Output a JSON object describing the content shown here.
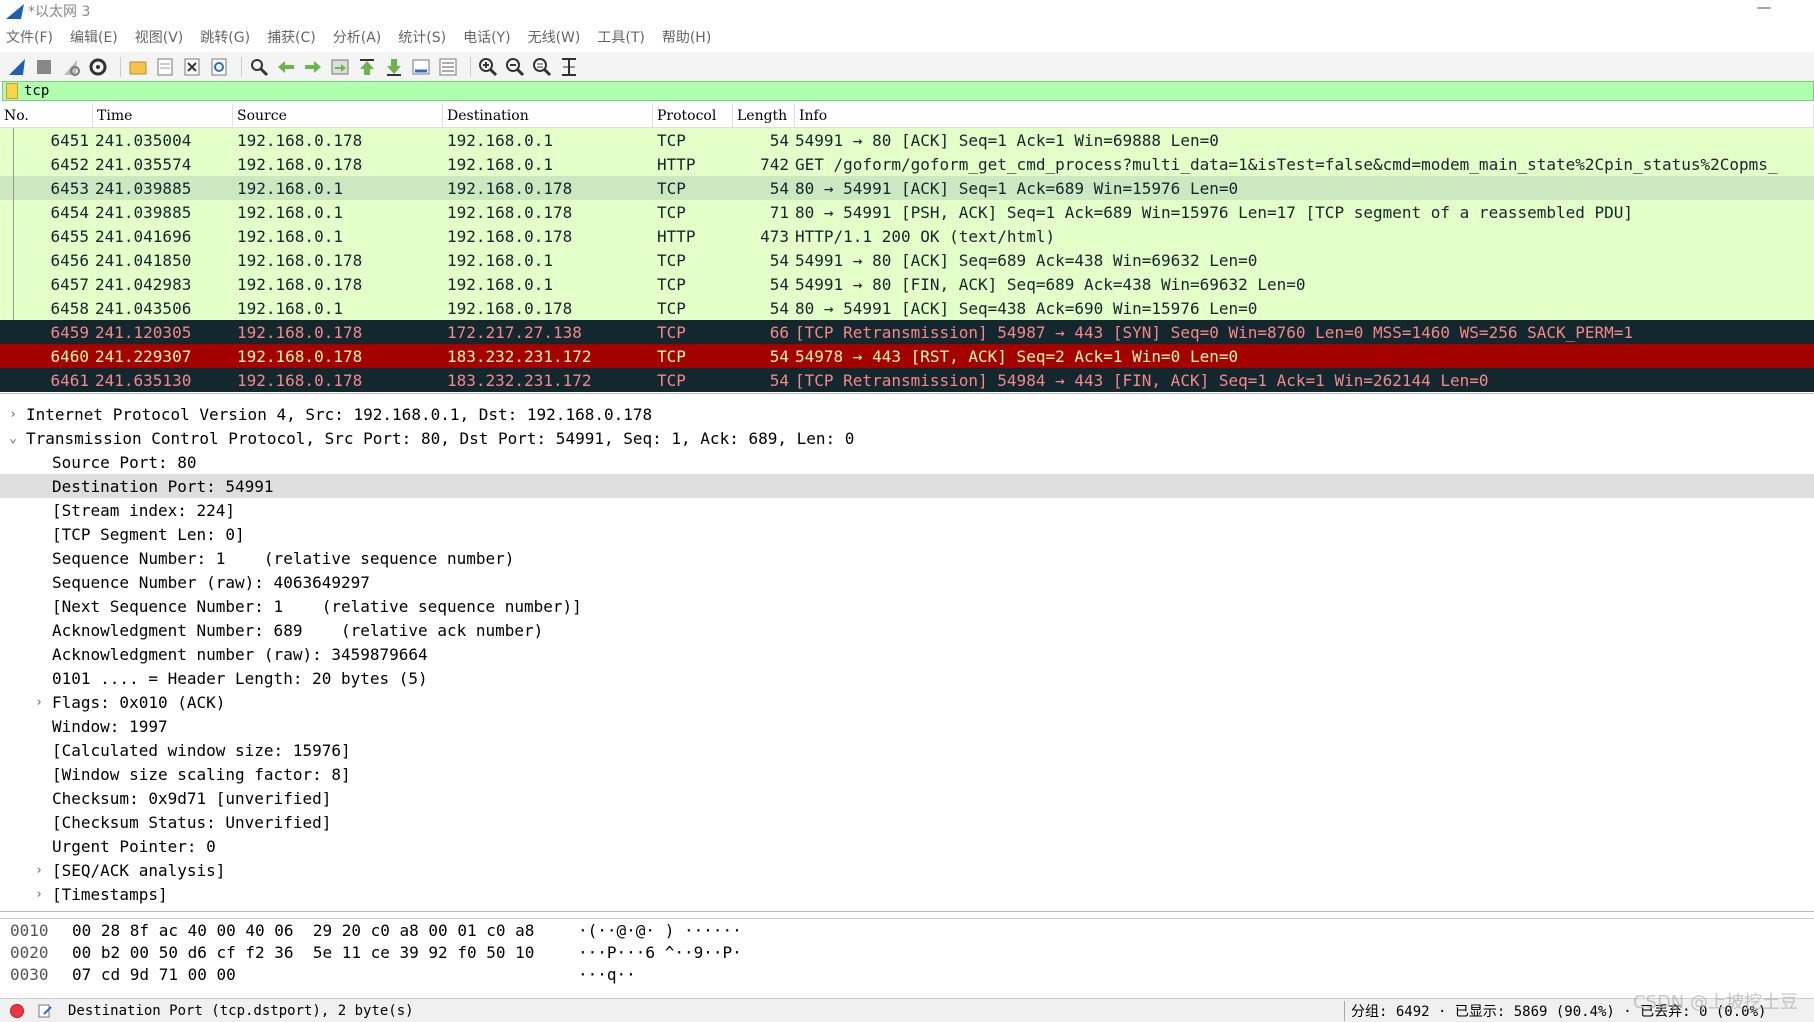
{
  "window": {
    "title": "*以太网 3"
  },
  "menu": [
    "文件(F)",
    "编辑(E)",
    "视图(V)",
    "跳转(G)",
    "捕获(C)",
    "分析(A)",
    "统计(S)",
    "电话(Y)",
    "无线(W)",
    "工具(T)",
    "帮助(H)"
  ],
  "toolbar_icons": [
    "shark-fin-start-icon",
    "stop-icon",
    "restart-icon",
    "gear-options-icon",
    "folder-open-icon",
    "save-file-icon",
    "close-file-icon",
    "reload-icon",
    "find-icon",
    "go-back-icon",
    "go-forward-icon",
    "go-to-packet-icon",
    "first-packet-icon",
    "last-packet-icon",
    "autoscroll-icon",
    "colorize-icon",
    "zoom-in-icon",
    "zoom-out-icon",
    "zoom-normal-icon",
    "resize-columns-icon"
  ],
  "filter": {
    "value": "tcp"
  },
  "columns": [
    "No.",
    "Time",
    "Source",
    "Destination",
    "Protocol",
    "Length",
    "Info"
  ],
  "colors": {
    "tcp_green": "#e4ffc7",
    "http_green": "#e4ffc7",
    "selected_row": "#cde8c1",
    "dark_row_bg": "#12272e",
    "dark_row_fg": "#f78787",
    "rst_row_bg": "#a40000",
    "rst_row_fg": "#fffc9c"
  },
  "packets": [
    {
      "no": "6451",
      "time": "241.035004",
      "src": "192.168.0.178",
      "dst": "192.168.0.1",
      "proto": "TCP",
      "len": "54",
      "info": "54991 → 80 [ACK] Seq=1 Ack=1 Win=69888 Len=0",
      "style": "tcp"
    },
    {
      "no": "6452",
      "time": "241.035574",
      "src": "192.168.0.178",
      "dst": "192.168.0.1",
      "proto": "HTTP",
      "len": "742",
      "info": "GET /goform/goform_get_cmd_process?multi_data=1&isTest=false&cmd=modem_main_state%2Cpin_status%2Copms_",
      "style": "http"
    },
    {
      "no": "6453",
      "time": "241.039885",
      "src": "192.168.0.1",
      "dst": "192.168.0.178",
      "proto": "TCP",
      "len": "54",
      "info": "80 → 54991 [ACK] Seq=1 Ack=689 Win=15976 Len=0",
      "style": "selected"
    },
    {
      "no": "6454",
      "time": "241.039885",
      "src": "192.168.0.1",
      "dst": "192.168.0.178",
      "proto": "TCP",
      "len": "71",
      "info": "80 → 54991 [PSH, ACK] Seq=1 Ack=689 Win=15976 Len=17 [TCP segment of a reassembled PDU]",
      "style": "tcp"
    },
    {
      "no": "6455",
      "time": "241.041696",
      "src": "192.168.0.1",
      "dst": "192.168.0.178",
      "proto": "HTTP",
      "len": "473",
      "info": "HTTP/1.1 200 OK  (text/html)",
      "style": "http"
    },
    {
      "no": "6456",
      "time": "241.041850",
      "src": "192.168.0.178",
      "dst": "192.168.0.1",
      "proto": "TCP",
      "len": "54",
      "info": "54991 → 80 [ACK] Seq=689 Ack=438 Win=69632 Len=0",
      "style": "tcp"
    },
    {
      "no": "6457",
      "time": "241.042983",
      "src": "192.168.0.178",
      "dst": "192.168.0.1",
      "proto": "TCP",
      "len": "54",
      "info": "54991 → 80 [FIN, ACK] Seq=689 Ack=438 Win=69632 Len=0",
      "style": "tcp"
    },
    {
      "no": "6458",
      "time": "241.043506",
      "src": "192.168.0.1",
      "dst": "192.168.0.178",
      "proto": "TCP",
      "len": "54",
      "info": "80 → 54991 [ACK] Seq=438 Ack=690 Win=15976 Len=0",
      "style": "tcp"
    },
    {
      "no": "6459",
      "time": "241.120305",
      "src": "192.168.0.178",
      "dst": "172.217.27.138",
      "proto": "TCP",
      "len": "66",
      "info": "[TCP Retransmission] 54987 → 443 [SYN] Seq=0 Win=8760 Len=0 MSS=1460 WS=256 SACK_PERM=1",
      "style": "dark"
    },
    {
      "no": "6460",
      "time": "241.229307",
      "src": "192.168.0.178",
      "dst": "183.232.231.172",
      "proto": "TCP",
      "len": "54",
      "info": "54978 → 443 [RST, ACK] Seq=2 Ack=1 Win=0 Len=0",
      "style": "rst"
    },
    {
      "no": "6461",
      "time": "241.635130",
      "src": "192.168.0.178",
      "dst": "183.232.231.172",
      "proto": "TCP",
      "len": "54",
      "info": "[TCP Retransmission] 54984 → 443 [FIN, ACK] Seq=1 Ack=1 Win=262144 Len=0",
      "style": "dark"
    }
  ],
  "details": [
    {
      "indent": 0,
      "arrow": "›",
      "text": "Internet Protocol Version 4, Src: 192.168.0.1, Dst: 192.168.0.178",
      "sel": false
    },
    {
      "indent": 0,
      "arrow": "⌄",
      "text": "Transmission Control Protocol, Src Port: 80, Dst Port: 54991, Seq: 1, Ack: 689, Len: 0",
      "sel": false
    },
    {
      "indent": 1,
      "arrow": "",
      "text": "Source Port: 80",
      "sel": false
    },
    {
      "indent": 1,
      "arrow": "",
      "text": "Destination Port: 54991",
      "sel": true
    },
    {
      "indent": 1,
      "arrow": "",
      "text": "[Stream index: 224]",
      "sel": false
    },
    {
      "indent": 1,
      "arrow": "",
      "text": "[TCP Segment Len: 0]",
      "sel": false
    },
    {
      "indent": 1,
      "arrow": "",
      "text": "Sequence Number: 1    (relative sequence number)",
      "sel": false
    },
    {
      "indent": 1,
      "arrow": "",
      "text": "Sequence Number (raw): 4063649297",
      "sel": false
    },
    {
      "indent": 1,
      "arrow": "",
      "text": "[Next Sequence Number: 1    (relative sequence number)]",
      "sel": false
    },
    {
      "indent": 1,
      "arrow": "",
      "text": "Acknowledgment Number: 689    (relative ack number)",
      "sel": false
    },
    {
      "indent": 1,
      "arrow": "",
      "text": "Acknowledgment number (raw): 3459879664",
      "sel": false
    },
    {
      "indent": 1,
      "arrow": "",
      "text": "0101 .... = Header Length: 20 bytes (5)",
      "sel": false
    },
    {
      "indent": 1,
      "arrow": "›",
      "text": "Flags: 0x010 (ACK)",
      "sel": false
    },
    {
      "indent": 1,
      "arrow": "",
      "text": "Window: 1997",
      "sel": false
    },
    {
      "indent": 1,
      "arrow": "",
      "text": "[Calculated window size: 15976]",
      "sel": false
    },
    {
      "indent": 1,
      "arrow": "",
      "text": "[Window size scaling factor: 8]",
      "sel": false
    },
    {
      "indent": 1,
      "arrow": "",
      "text": "Checksum: 0x9d71 [unverified]",
      "sel": false
    },
    {
      "indent": 1,
      "arrow": "",
      "text": "[Checksum Status: Unverified]",
      "sel": false
    },
    {
      "indent": 1,
      "arrow": "",
      "text": "Urgent Pointer: 0",
      "sel": false
    },
    {
      "indent": 1,
      "arrow": "›",
      "text": "[SEQ/ACK analysis]",
      "sel": false
    },
    {
      "indent": 1,
      "arrow": "›",
      "text": "[Timestamps]",
      "sel": false
    }
  ],
  "bytes": [
    {
      "off": "0010",
      "hex": "00 28 8f ac 40 00 40 06  29 20 c0 a8 00 01 c0 a8",
      "ascii": "·(··@·@· ) ······"
    },
    {
      "off": "0020",
      "hex": "00 b2 00 50 d6 cf f2 36  5e 11 ce 39 92 f0 50 10",
      "ascii": "···P···6 ^··9··P·"
    },
    {
      "off": "0030",
      "hex": "07 cd 9d 71 00 00",
      "ascii": "···q··"
    }
  ],
  "status": {
    "field_info": "Destination Port (tcp.dstport), 2 byte(s)",
    "stats": "分组: 6492 · 已显示: 5869 (90.4%) · 已丢弃: 0 (0.0%)",
    "watermark": "CSDN @上坡挖土豆"
  }
}
